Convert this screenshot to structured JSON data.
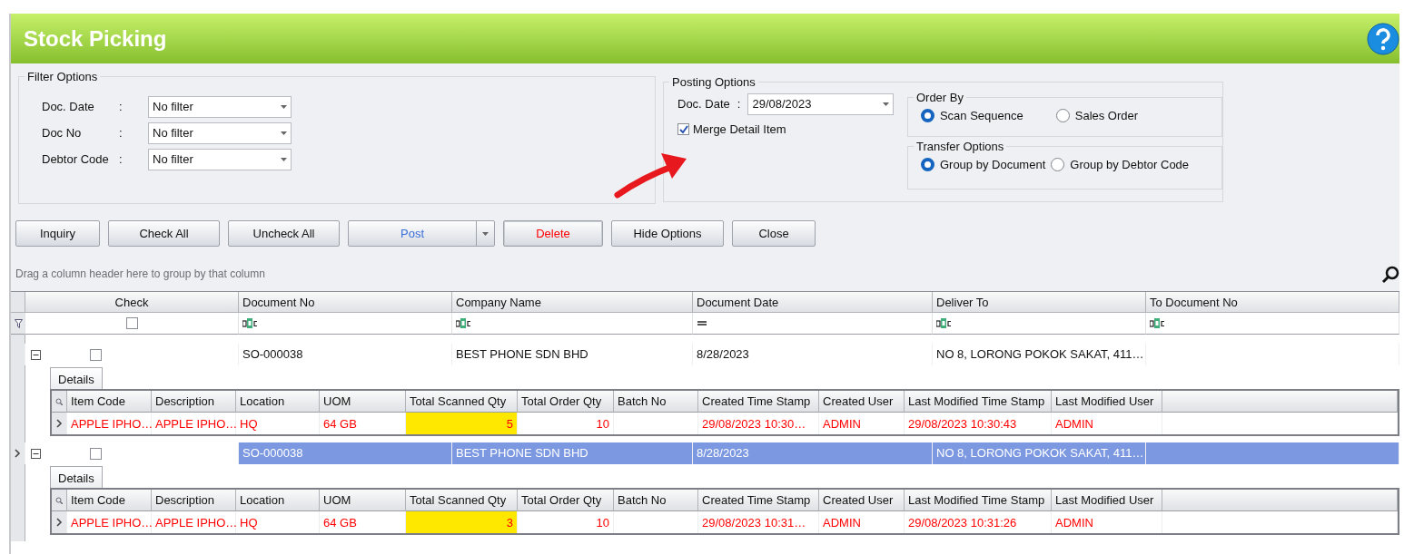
{
  "window": {
    "title": "Stock Picking"
  },
  "filter_options": {
    "title": "Filter Options",
    "fields": [
      {
        "label": "Doc. Date",
        "separator": ":",
        "value": "No filter"
      },
      {
        "label": "Doc No",
        "separator": ":",
        "value": "No filter"
      },
      {
        "label": "Debtor Code",
        "separator": ":",
        "value": "No filter"
      }
    ]
  },
  "posting_options": {
    "title": "Posting Options",
    "doc_date": {
      "label": "Doc. Date",
      "separator": ":",
      "value": "29/08/2023"
    },
    "merge_detail_item": {
      "label": "Merge Detail Item",
      "checked": true
    },
    "order_by": {
      "title": "Order By",
      "options": [
        {
          "label": "Scan Sequence",
          "selected": true
        },
        {
          "label": "Sales Order",
          "selected": false
        }
      ]
    },
    "transfer_options": {
      "title": "Transfer Options",
      "options": [
        {
          "label": "Group by Document",
          "selected": true
        },
        {
          "label": "Group by Debtor Code",
          "selected": false
        }
      ]
    }
  },
  "buttons": [
    {
      "label": "Inquiry",
      "kind": "plain"
    },
    {
      "label": "Check All",
      "kind": "plain"
    },
    {
      "label": "Uncheck All",
      "kind": "plain"
    },
    {
      "label": "Post",
      "kind": "split"
    },
    {
      "label": "Delete",
      "kind": "danger"
    },
    {
      "label": "Hide Options",
      "kind": "plain"
    },
    {
      "label": "Close",
      "kind": "plain"
    }
  ],
  "group_panel": {
    "hint": "Drag a column header here to group by that column"
  },
  "grid": {
    "columns": [
      "Check",
      "Document No",
      "Company Name",
      "Document Date",
      "Deliver To",
      "To Document No"
    ],
    "filter_row": [
      {
        "kind": "checkbox",
        "checked": false
      },
      {
        "kind": "text"
      },
      {
        "kind": "text"
      },
      {
        "kind": "equals"
      },
      {
        "kind": "text"
      },
      {
        "kind": "text"
      }
    ],
    "rows": [
      {
        "selected": false,
        "expanded": true,
        "checked": false,
        "cells": [
          "",
          "SO-000038",
          "BEST PHONE SDN BHD",
          "8/28/2023",
          "NO 8, LORONG POKOK SAKAT, 411…",
          ""
        ],
        "detail": {
          "tab": "Details",
          "columns": [
            "Item Code",
            "Description",
            "Location",
            "UOM",
            "Total Scanned Qty",
            "Total Order Qty",
            "Batch No",
            "Created Time Stamp",
            "Created User",
            "Last Modified Time Stamp",
            "Last Modified User"
          ],
          "rows": [
            {
              "cells": [
                {
                  "text": "APPLE IPHO…",
                  "highlighted": false
                },
                {
                  "text": "APPLE IPHO…",
                  "highlighted": false
                },
                {
                  "text": "HQ",
                  "highlighted": false
                },
                {
                  "text": "64 GB",
                  "highlighted": false
                },
                {
                  "text": "5",
                  "highlighted": true
                },
                {
                  "text": "10",
                  "highlighted": false
                },
                {
                  "text": "",
                  "highlighted": false
                },
                {
                  "text": "29/08/2023 10:30…",
                  "highlighted": false
                },
                {
                  "text": "ADMIN",
                  "highlighted": false
                },
                {
                  "text": "29/08/2023 10:30:43",
                  "highlighted": false
                },
                {
                  "text": "ADMIN",
                  "highlighted": false
                }
              ]
            }
          ]
        }
      },
      {
        "selected": true,
        "expanded": true,
        "checked": false,
        "cells": [
          "",
          "SO-000038",
          "BEST PHONE SDN BHD",
          "8/28/2023",
          "NO 8, LORONG POKOK SAKAT, 411…",
          ""
        ],
        "detail": {
          "tab": "Details",
          "columns": [
            "Item Code",
            "Description",
            "Location",
            "UOM",
            "Total Scanned Qty",
            "Total Order Qty",
            "Batch No",
            "Created Time Stamp",
            "Created User",
            "Last Modified Time Stamp",
            "Last Modified User"
          ],
          "rows": [
            {
              "cells": [
                {
                  "text": "APPLE IPHO…",
                  "highlighted": false
                },
                {
                  "text": "APPLE IPHO…",
                  "highlighted": false
                },
                {
                  "text": "HQ",
                  "highlighted": false
                },
                {
                  "text": "64 GB",
                  "highlighted": false
                },
                {
                  "text": "3",
                  "highlighted": true
                },
                {
                  "text": "10",
                  "highlighted": false
                },
                {
                  "text": "",
                  "highlighted": false
                },
                {
                  "text": "29/08/2023 10:31…",
                  "highlighted": false
                },
                {
                  "text": "ADMIN",
                  "highlighted": false
                },
                {
                  "text": "29/08/2023 10:31:26",
                  "highlighted": false
                },
                {
                  "text": "ADMIN",
                  "highlighted": false
                }
              ]
            }
          ]
        }
      }
    ]
  }
}
